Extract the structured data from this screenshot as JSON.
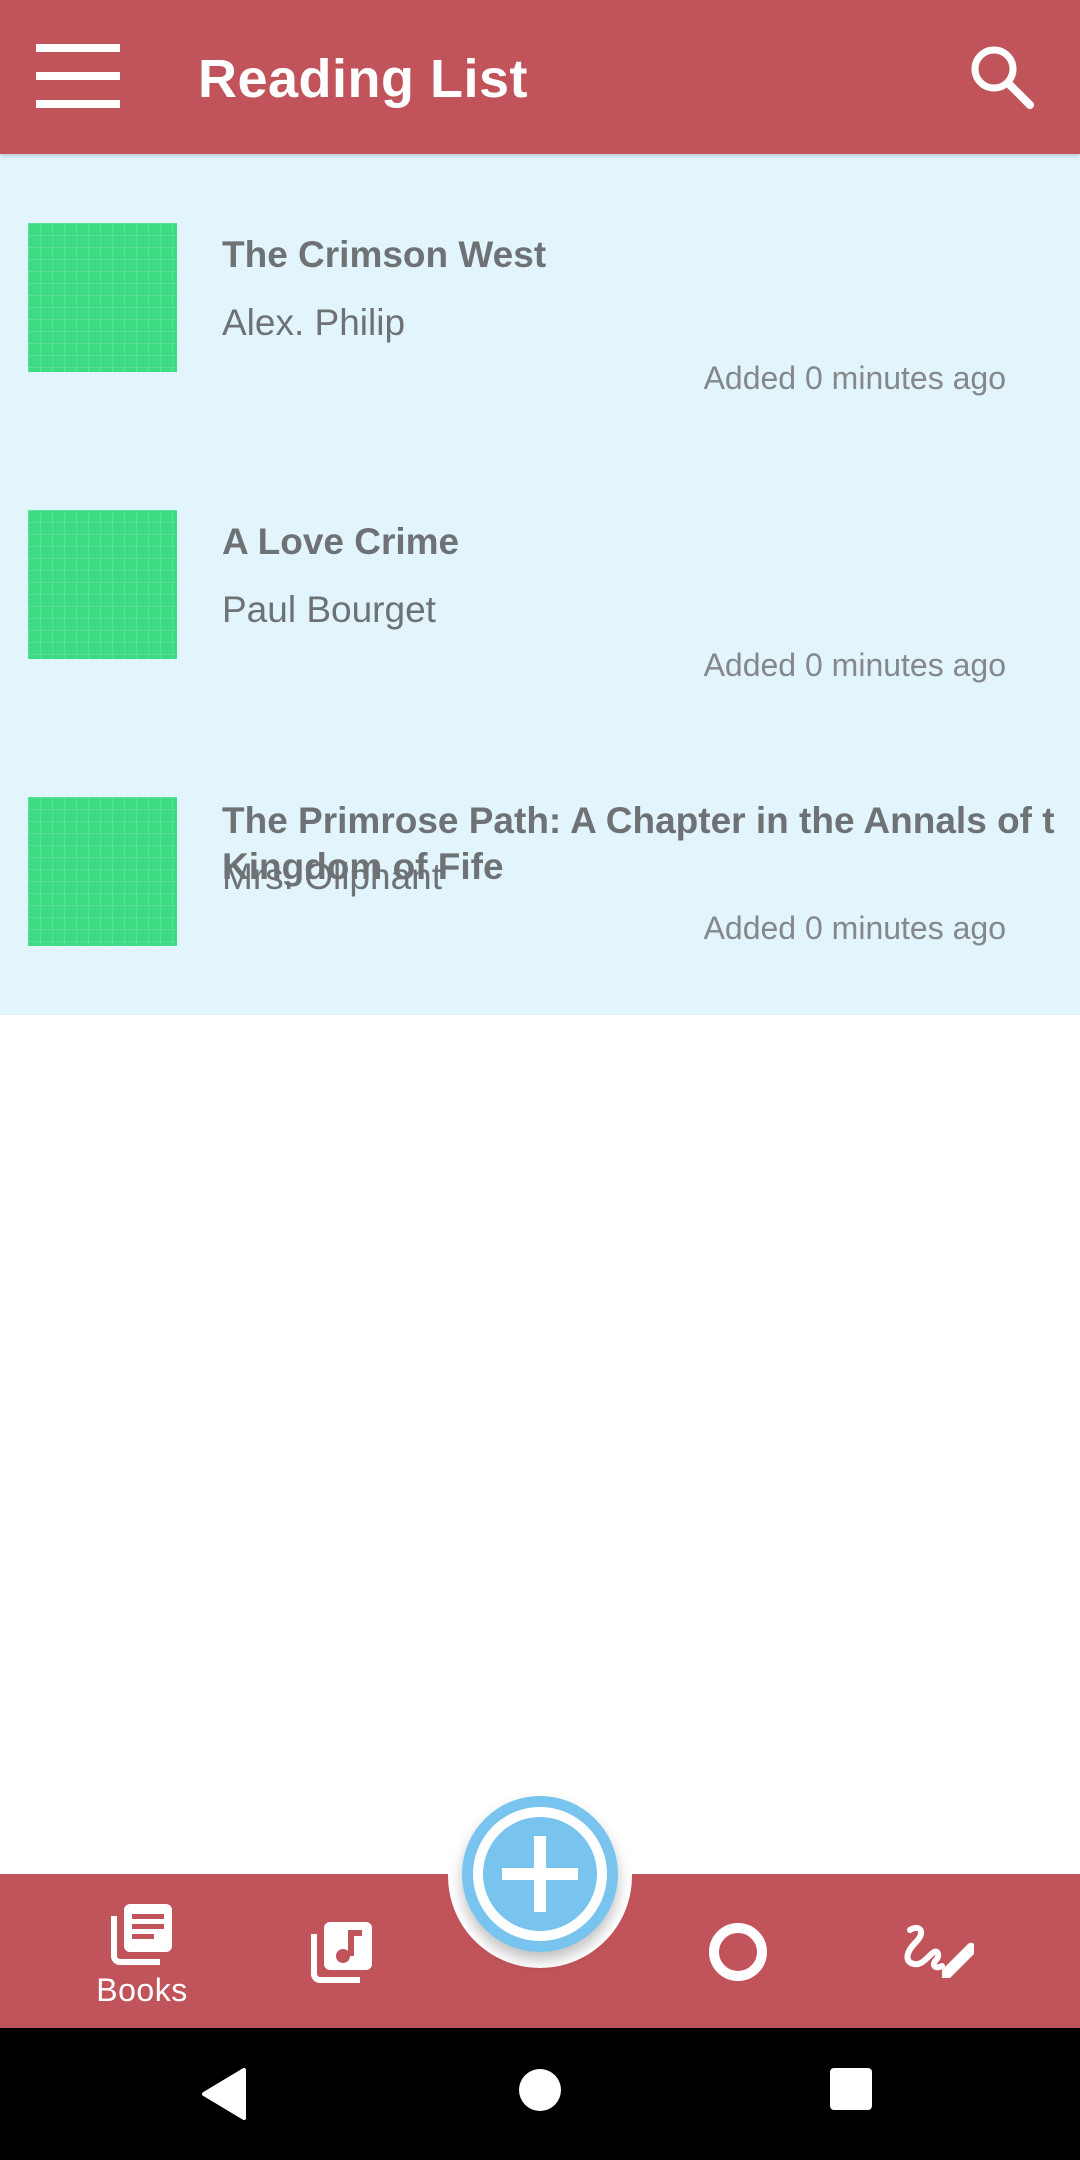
{
  "app_bar": {
    "title": "Reading List",
    "menu_icon": "hamburger-menu-icon",
    "search_icon": "search-icon",
    "background_color": "#c1535b"
  },
  "books": [
    {
      "title": "The Crimson West",
      "author": "Alex. Philip",
      "added": "Added 0 minutes ago"
    },
    {
      "title": "A Love Crime",
      "author": "Paul Bourget",
      "added": "Added 0 minutes ago"
    },
    {
      "title": "The Primrose Path: A Chapter in the Annals of t Kingdom of Fife",
      "author": "Mrs. Oliphant",
      "added": "Added 0 minutes ago"
    }
  ],
  "list_background_color": "#e2f5fc",
  "cover_color": "#3ddc84",
  "bottom_nav": {
    "items": [
      {
        "label": "Books",
        "icon": "books-icon",
        "selected": true
      },
      {
        "label": "",
        "icon": "audio-library-icon",
        "selected": false
      },
      {
        "label": "",
        "icon": "circle-icon",
        "selected": false
      },
      {
        "label": "",
        "icon": "signature-icon",
        "selected": false
      }
    ],
    "fab_icon": "add-circle-icon",
    "fab_color": "#78c4ef"
  },
  "system_nav": {
    "back_icon": "back-triangle-icon",
    "home_icon": "home-circle-icon",
    "recents_icon": "recents-square-icon"
  }
}
